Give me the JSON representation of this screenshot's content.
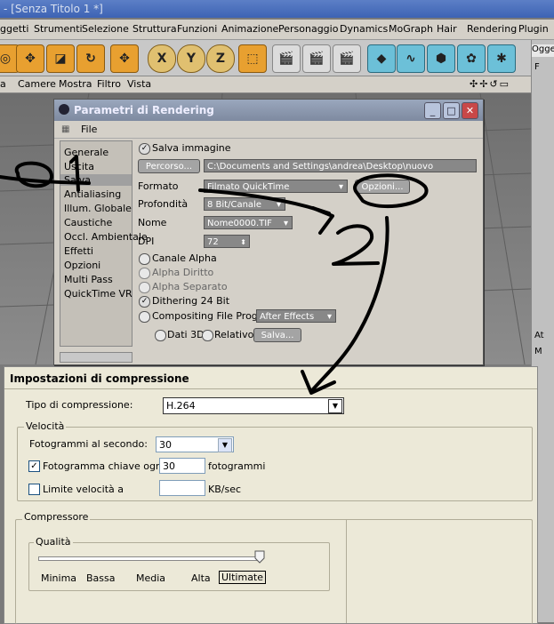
{
  "app": {
    "title": "- [Senza Titolo 1 *]"
  },
  "menubar": [
    "ggetti",
    "Strumenti",
    "Selezione",
    "Struttura",
    "Funzioni",
    "Animazione",
    "Personaggio",
    "Dynamics",
    "MoGraph",
    "Hair",
    "Rendering",
    "Plugin"
  ],
  "toolbar": {
    "axis_x": "X",
    "axis_y": "Y",
    "axis_z": "Z"
  },
  "right_panel": {
    "header": "Ogge",
    "item1": "F",
    "item2": "At",
    "item3": "M"
  },
  "viewbar": [
    "a",
    "Camere",
    "Mostra",
    "Filtro",
    "Vista"
  ],
  "viewbar_icons": "✣✢↺▭",
  "render_window": {
    "title": "Parametri di Rendering",
    "menu_file": "File",
    "sections": [
      "Generale",
      "Uscita",
      "Salva",
      "Antialiasing",
      "Illum. Globale",
      "Caustiche",
      "Occl. Ambientale",
      "Effetti",
      "Opzioni",
      "Multi Pass",
      "QuickTime VR"
    ],
    "selected_section": "Salva",
    "save_image_label": "Salva immagine",
    "path_button": "Percorso...",
    "path_value": "C:\\Documents and Settings\\andrea\\Desktop\\nuovo",
    "format_label": "Formato",
    "format_value": "Filmato QuickTime",
    "options_button": "Opzioni...",
    "depth_label": "Profondità",
    "depth_value": "8 Bit/Canale",
    "name_label": "Nome",
    "name_value": "Nome0000.TIF",
    "dpi_label": "DPI",
    "dpi_value": "72",
    "alpha_channel": "Canale Alpha",
    "alpha_straight": "Alpha Diritto",
    "alpha_separate": "Alpha Separato",
    "dithering": "Dithering 24 Bit",
    "compositing": "Compositing File Progetto",
    "compositing_app": "After Effects",
    "data3d": "Dati 3D",
    "relative": "Relativo",
    "save_button": "Salva..."
  },
  "compression_dialog": {
    "title": "Impostazioni di compressione",
    "type_label": "Tipo di compressione:",
    "type_value": "H.264",
    "speed_group": "Velocità",
    "fps_label": "Fotogrammi al secondo:",
    "fps_value": "30",
    "keyframe_label": "Fotogramma chiave ogni",
    "keyframe_value": "30",
    "keyframe_unit": "fotogrammi",
    "keyframe_checked": true,
    "limit_label": "Limite velocità a",
    "limit_value": "",
    "limit_unit": "KB/sec",
    "compressor_group": "Compressore",
    "quality_group": "Qualità",
    "quality_ticks": [
      "Minima",
      "Bassa",
      "Media",
      "Alta",
      "Ultimate"
    ],
    "quality_level": 1.0
  },
  "annotations": {
    "label1": "01",
    "label2": "2"
  }
}
